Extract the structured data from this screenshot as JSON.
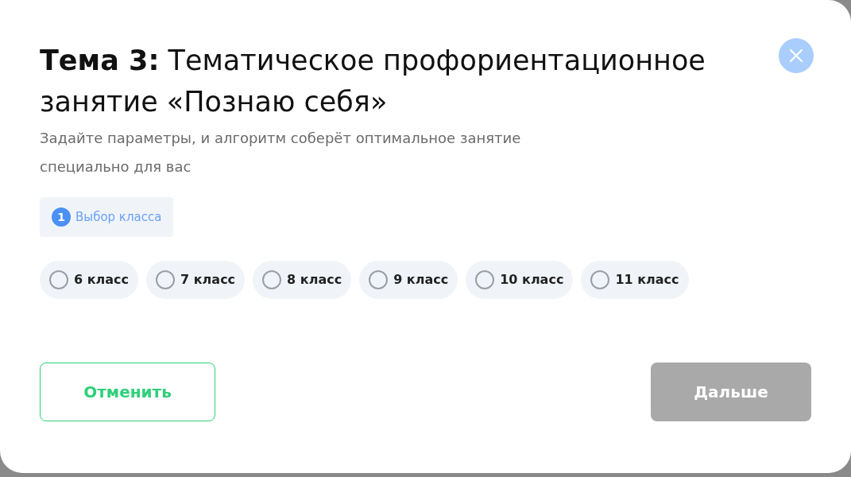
{
  "dialog": {
    "title_prefix": "Тема 3:",
    "title": "Тематическое профориентационное занятие «Познаю себя»",
    "subtitle": "Задайте параметры, и алгоритм соберёт оптимальное занятие специально для вас"
  },
  "step": {
    "number": "1",
    "label": "Выбор класса"
  },
  "options": [
    {
      "label": "6 класс",
      "selected": false
    },
    {
      "label": "7 класс",
      "selected": false
    },
    {
      "label": "8 класс",
      "selected": false
    },
    {
      "label": "9 класс",
      "selected": false
    },
    {
      "label": "10 класс",
      "selected": false
    },
    {
      "label": "11 класс",
      "selected": false
    }
  ],
  "buttons": {
    "cancel": {
      "label": "Отменить"
    },
    "next": {
      "label": "Дальше",
      "disabled": true
    }
  }
}
